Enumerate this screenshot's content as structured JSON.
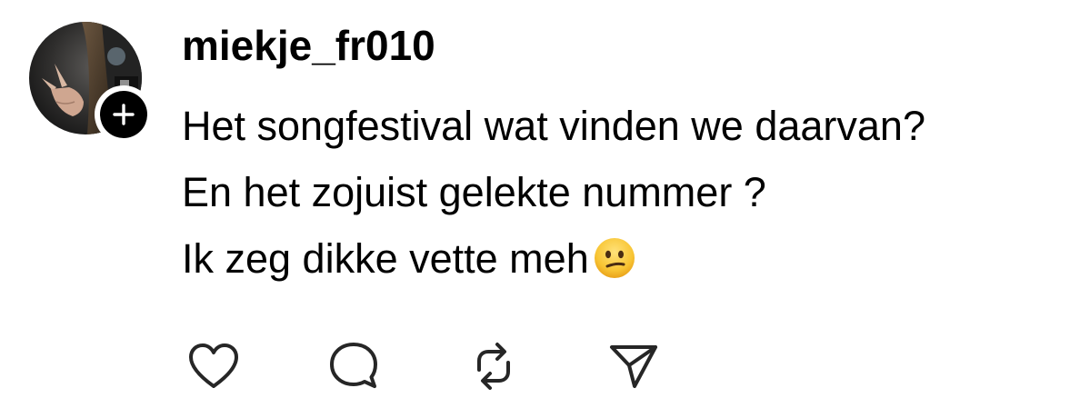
{
  "post": {
    "username": "miekje_fr010",
    "lines": [
      "Het songfestival wat vinden we daarvan?",
      "En het zojuist gelekte nummer ?",
      "Ik zeg dikke vette meh"
    ],
    "emoji": "neutral-face"
  },
  "actions": {
    "icons": [
      "heart-icon",
      "comment-icon",
      "repost-icon",
      "share-icon"
    ]
  },
  "colors": {
    "text": "#000000",
    "icon_stroke": "#262626",
    "badge": "#000000",
    "background": "#ffffff"
  }
}
